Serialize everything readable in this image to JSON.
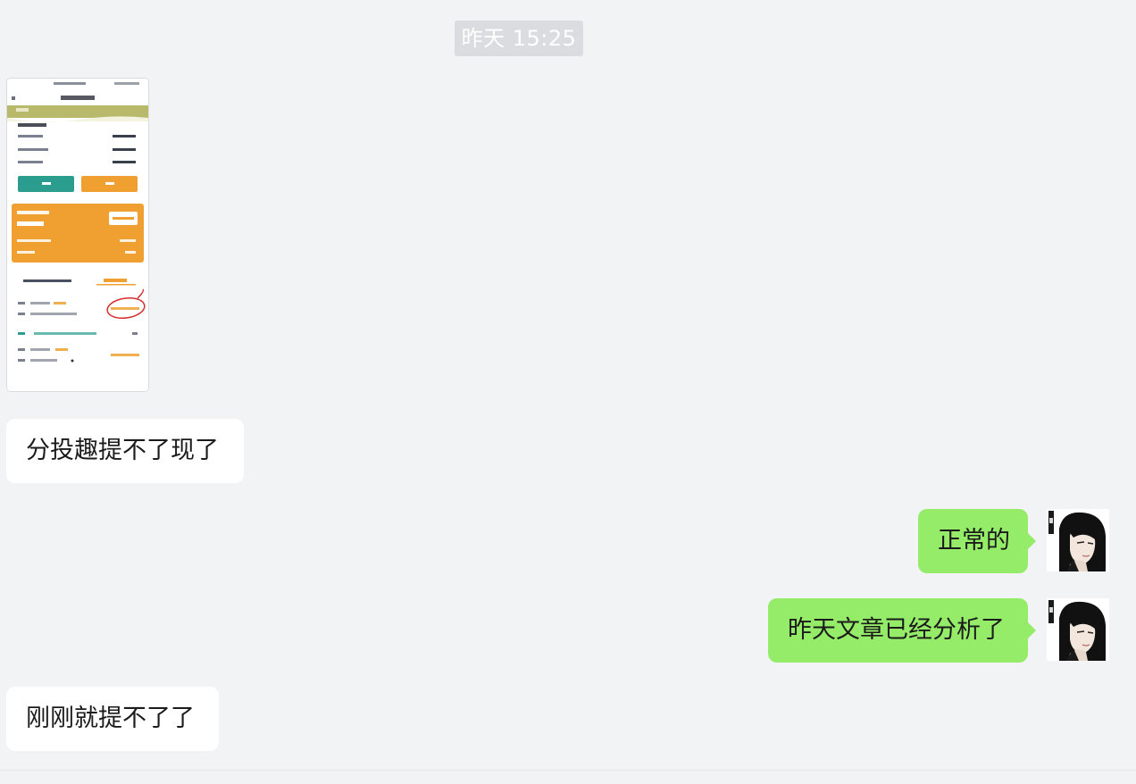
{
  "chat": {
    "timestamp": "昨天 15:25",
    "messages": [
      {
        "side": "incoming",
        "type": "image",
        "content": "screenshot-thumbnail"
      },
      {
        "side": "incoming",
        "type": "text",
        "text": "分投趣提不了现了"
      },
      {
        "side": "outgoing",
        "type": "text",
        "text": "正常的"
      },
      {
        "side": "outgoing",
        "type": "text",
        "text": "昨天文章已经分析了"
      },
      {
        "side": "incoming",
        "type": "text",
        "text": "刚刚就提不了了"
      }
    ]
  },
  "colors": {
    "background": "#f2f3f5",
    "incoming_bubble": "#ffffff",
    "outgoing_bubble": "#95ec69",
    "timestamp_bg": "#dadcdf",
    "thumbnail_teal_button": "#2a9d8f",
    "thumbnail_orange": "#f0a030",
    "annotation_red": "#d62d2d"
  }
}
